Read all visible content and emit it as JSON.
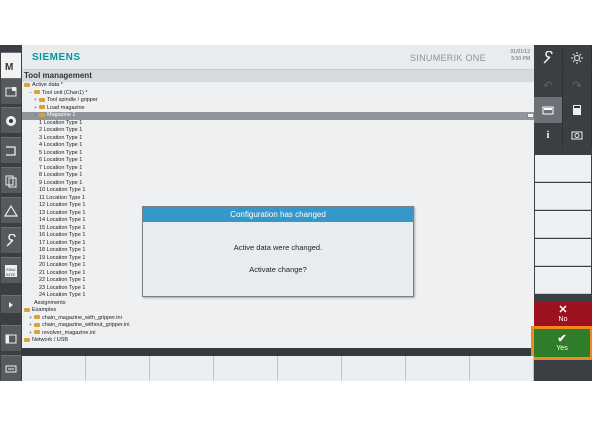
{
  "header": {
    "logo": "SIEMENS",
    "product": "SINUMERIK ONE",
    "date": "01/01/12",
    "time": "5:50 PM"
  },
  "main": {
    "title": "Tool management",
    "tree": [
      {
        "label": "Active data *",
        "indent": 0,
        "icon": "folder",
        "expand": ""
      },
      {
        "label": "Tool unit (Chan1) *",
        "indent": 1,
        "icon": "folder",
        "expand": "-"
      },
      {
        "label": "Tool spindle / gripper",
        "indent": 2,
        "icon": "folder",
        "expand": "+"
      },
      {
        "label": "Load magazine",
        "indent": 2,
        "icon": "folder",
        "expand": "+"
      },
      {
        "label": "Magazine 1",
        "indent": 2,
        "icon": "folder",
        "expand": "-",
        "selected": true
      },
      {
        "label": "1 Location Type 1",
        "indent": 3
      },
      {
        "label": "2 Location Type 1",
        "indent": 3
      },
      {
        "label": "3 Location Type 1",
        "indent": 3
      },
      {
        "label": "4 Location Type 1",
        "indent": 3
      },
      {
        "label": "5 Location Type 1",
        "indent": 3
      },
      {
        "label": "6 Location Type 1",
        "indent": 3
      },
      {
        "label": "7 Location Type 1",
        "indent": 3
      },
      {
        "label": "8 Location Type 1",
        "indent": 3
      },
      {
        "label": "9 Location Type 1",
        "indent": 3
      },
      {
        "label": "10 Location Type 1",
        "indent": 3
      },
      {
        "label": "11 Location Type 1",
        "indent": 3
      },
      {
        "label": "12 Location Type 1",
        "indent": 3
      },
      {
        "label": "13 Location Type 1",
        "indent": 3
      },
      {
        "label": "14 Location Type 1",
        "indent": 3
      },
      {
        "label": "15 Location Type 1",
        "indent": 3
      },
      {
        "label": "16 Location Type 1",
        "indent": 3
      },
      {
        "label": "17 Location Type 1",
        "indent": 3
      },
      {
        "label": "18 Location Type 1",
        "indent": 3
      },
      {
        "label": "19 Location Type 1",
        "indent": 3
      },
      {
        "label": "20 Location Type 1",
        "indent": 3
      },
      {
        "label": "21 Location Type 1",
        "indent": 3
      },
      {
        "label": "22 Location Type 1",
        "indent": 3
      },
      {
        "label": "23 Location Type 1",
        "indent": 3
      },
      {
        "label": "24 Location Type 1",
        "indent": 3
      },
      {
        "label": "Assignments",
        "indent": 2
      },
      {
        "label": "Examples",
        "indent": 0,
        "icon": "folder",
        "expand": ""
      },
      {
        "label": "chain_magazine_with_gripper.ini",
        "indent": 1,
        "icon": "folder",
        "expand": "+"
      },
      {
        "label": "chain_magazine_without_gripper.ini",
        "indent": 1,
        "icon": "folder",
        "expand": "+"
      },
      {
        "label": "revolver_magazine.ini",
        "indent": 1,
        "icon": "folder",
        "expand": "+"
      },
      {
        "label": "Network / USB",
        "indent": 0,
        "icon": "folder",
        "expand": ""
      }
    ]
  },
  "dialog": {
    "title": "Configuration has changed",
    "message_line1": "Active data were changed.",
    "message_line2": "Activate change?"
  },
  "softkeys": {
    "no_label": "No",
    "yes_label": "Yes"
  },
  "colors": {
    "accent": "#3598c9",
    "no": "#9d1120",
    "yes": "#2f7d2a",
    "highlight": "#f08a1c"
  }
}
